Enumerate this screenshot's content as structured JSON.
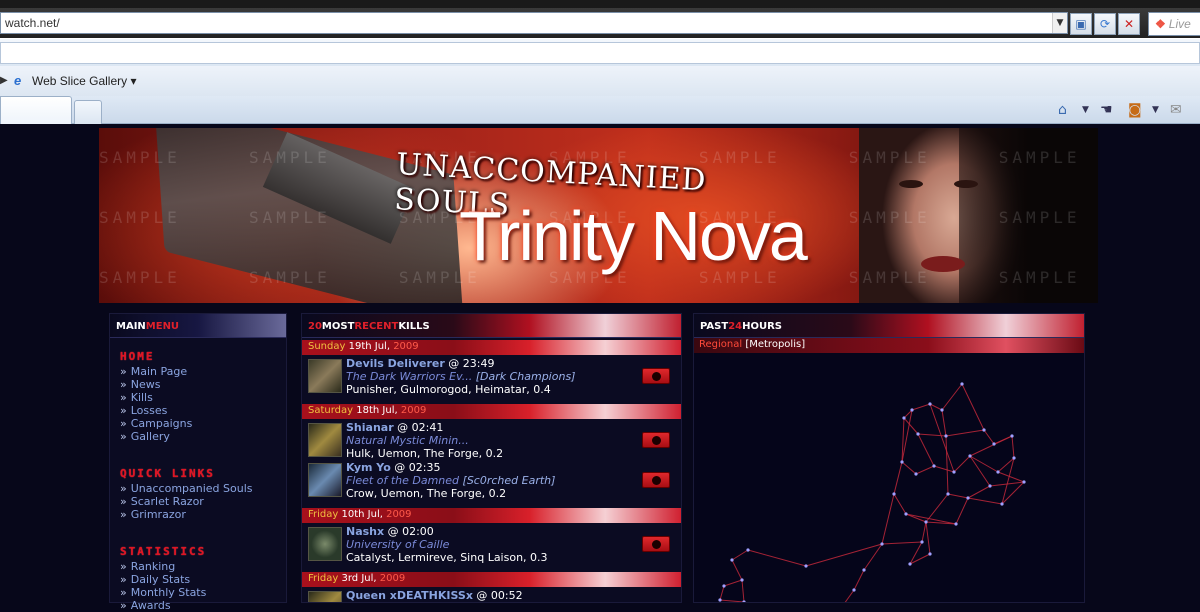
{
  "browser": {
    "address": "watch.net/",
    "search_placeholder": "Live",
    "favorites_bar": {
      "web_slice_label": "Web Slice Gallery"
    }
  },
  "banner": {
    "subtitle": "UNACCOMPANIED SOULS",
    "title": "Trinity Nova",
    "watermark": "SAMPLE"
  },
  "main_menu": {
    "head_white": "MAIN",
    "head_red": "MENU",
    "sections": [
      {
        "title": "HOME",
        "links": [
          "Main Page",
          "News",
          "Kills",
          "Losses",
          "Campaigns",
          "Gallery"
        ]
      },
      {
        "title": "QUICK LINKS",
        "links": [
          "Unaccompanied Souls",
          "Scarlet Razor",
          "Grimrazor"
        ]
      },
      {
        "title": "STATISTICS",
        "links": [
          "Ranking",
          "Daily Stats",
          "Monthly Stats",
          "Awards"
        ]
      }
    ]
  },
  "kills_panel": {
    "head_num": "20",
    "head_most": "MOST",
    "head_recent": "RECENT",
    "head_kills": "KILLS",
    "days": [
      {
        "dow": "Sunday",
        "date": "19th Jul,",
        "year": "2009"
      },
      {
        "dow": "Saturday",
        "date": "18th Jul,",
        "year": "2009"
      },
      {
        "dow": "Friday",
        "date": "10th Jul,",
        "year": "2009"
      },
      {
        "dow": "Friday",
        "date": "3rd Jul,",
        "year": "2009"
      }
    ],
    "kills": [
      {
        "name": "Devils Deliverer",
        "time": " @ 23:49",
        "corp": "The Dark Warriors Ev...",
        "alliance": "[Dark Champions]",
        "loc": "Punisher, Gulmorogod, Heimatar, 0.4"
      },
      {
        "name": "Shianar",
        "time": " @ 02:41",
        "corp": "Natural Mystic Minin...",
        "alliance": "",
        "loc": "Hulk, Uemon, The Forge, 0.2"
      },
      {
        "name": "Kym Yo",
        "time": " @ 02:35",
        "corp": "Fleet of the Damned",
        "alliance": "[Sc0rched Earth]",
        "loc": "Crow, Uemon, The Forge, 0.2"
      },
      {
        "name": "Nashx",
        "time": " @ 02:00",
        "corp": "University of Caille",
        "alliance": "",
        "loc": "Catalyst, Lermireve, Sinq Laison, 0.3"
      },
      {
        "name": "Queen xDEATHKISSx",
        "time": " @ 00:52",
        "corp": "",
        "alliance": "",
        "loc": ""
      }
    ]
  },
  "past24": {
    "head_white": "PAST",
    "head_red": "24",
    "head_white2": "HOURS",
    "region_label": "Regional",
    "region_bracket_open": " [",
    "region_name": "Metropolis",
    "region_bracket_close": "]"
  },
  "colors": {
    "accent_red": "#e0202a",
    "link_blue": "#8aa4e0",
    "background": "#07071a"
  }
}
